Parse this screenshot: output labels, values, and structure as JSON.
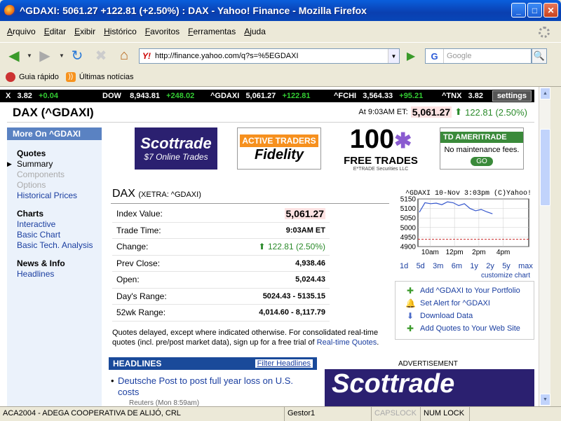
{
  "window": {
    "title": "^GDAXI: 5061.27 +122.81 (+2.50%) : DAX - Yahoo! Finance - Mozilla Firefox",
    "minimize": "_",
    "maximize": "□",
    "close": "✕"
  },
  "menu": [
    "Arquivo",
    "Editar",
    "Exibir",
    "Histórico",
    "Favoritos",
    "Ferramentas",
    "Ajuda"
  ],
  "nav": {
    "url": "http://finance.yahoo.com/q?s=%5EGDAXI",
    "url_favicon": "Y!",
    "search_engine": "G",
    "search_placeholder": "Google"
  },
  "bookmarks": [
    {
      "label": "Guia rápido",
      "icon": "bookmark-star-icon"
    },
    {
      "label": "Últimas notícias",
      "icon": "rss-icon"
    }
  ],
  "ticker": [
    {
      "sym": "X",
      "val": "3.82",
      "chg": "+0.04"
    },
    {
      "sym": "DOW",
      "val": "8,943.81",
      "chg": "+248.02"
    },
    {
      "sym": "^GDAXI",
      "val": "5,061.27",
      "chg": "+122.81"
    },
    {
      "sym": "^FCHI",
      "val": "3,564.33",
      "chg": "+95.21"
    },
    {
      "sym": "^TNX",
      "val": "3.82",
      "chg": ""
    }
  ],
  "ticker_settings": "settings",
  "quote": {
    "name": "DAX (^GDAXI)",
    "time_prefix": "At 9:03AM ET:",
    "price": "5,061.27",
    "change": "122.81 (2.50%)"
  },
  "sidebar": {
    "header": "More On ^GDAXI",
    "groups": [
      {
        "title": "Quotes",
        "items": [
          {
            "label": "Summary",
            "state": "current"
          },
          {
            "label": "Components",
            "state": "disabled"
          },
          {
            "label": "Options",
            "state": "disabled"
          },
          {
            "label": "Historical Prices",
            "state": "link"
          }
        ]
      },
      {
        "title": "Charts",
        "items": [
          {
            "label": "Interactive",
            "state": "link"
          },
          {
            "label": "Basic Chart",
            "state": "link"
          },
          {
            "label": "Basic Tech. Analysis",
            "state": "link"
          }
        ]
      },
      {
        "title": "News & Info",
        "items": [
          {
            "label": "Headlines",
            "state": "link"
          }
        ]
      }
    ]
  },
  "ads": {
    "scottrade_brand": "Scottrade",
    "scottrade_tag": "$7 Online Trades",
    "fidelity_top": "ACTIVE TRADERS",
    "fidelity_brand": "Fidelity",
    "etrade_num": "100",
    "etrade_text": "FREE TRADES",
    "etrade_small": "E*TRADE Securities LLC",
    "ameritrade_brand": "TD AMERITRADE",
    "ameritrade_msg": "No maintenance fees.",
    "ameritrade_go": "GO"
  },
  "quote_table": {
    "title": "DAX",
    "exchange": "(XETRA: ^GDAXI)",
    "rows": [
      {
        "label": "Index Value:",
        "value": "5,061.27"
      },
      {
        "label": "Trade Time:",
        "value": "9:03AM ET"
      },
      {
        "label": "Change:",
        "value": "122.81 (2.50%)"
      },
      {
        "label": "Prev Close:",
        "value": "4,938.46"
      },
      {
        "label": "Open:",
        "value": "5,024.43"
      },
      {
        "label": "Day's Range:",
        "value": "5024.43 - 5135.15"
      },
      {
        "label": "52wk Range:",
        "value": "4,014.60 - 8,117.79"
      }
    ]
  },
  "disclaimer": "Quotes delayed, except where indicated otherwise. For consolidated real-time quotes (incl. pre/post market data), sign up for a free trial of",
  "disclaimer_link": "Real-time Quotes",
  "chart_data": {
    "type": "line",
    "title": "^GDAXI 10-Nov 3:03pm (C)Yahoo!",
    "x": [
      "9:05",
      "9:30",
      "10:00",
      "10:30",
      "11:00",
      "11:30",
      "12:00",
      "12:30",
      "13:00",
      "13:30",
      "14:00",
      "14:30",
      "15:00",
      "15:03"
    ],
    "y": [
      5080,
      5130,
      5125,
      5128,
      5120,
      5135,
      5130,
      5115,
      5125,
      5100,
      5088,
      5095,
      5082,
      5072
    ],
    "prev_close": 4938.46,
    "yticks": [
      "5150",
      "5100",
      "5050",
      "5000",
      "4950",
      "4900"
    ],
    "xticks": [
      "10am",
      "12pm",
      "2pm",
      "4pm"
    ],
    "ylim": [
      4900,
      5150
    ]
  },
  "chart_periods": [
    "1d",
    "5d",
    "3m",
    "6m",
    "1y",
    "2y",
    "5y",
    "max"
  ],
  "chart_customize": "customize chart",
  "actions": [
    {
      "label": "Add ^GDAXI to Your Portfolio",
      "icon": "plus-icon"
    },
    {
      "label": "Set Alert for ^GDAXI",
      "icon": "bell-icon"
    },
    {
      "label": "Download Data",
      "icon": "download-icon"
    },
    {
      "label": "Add Quotes to Your Web Site",
      "icon": "plus-icon"
    }
  ],
  "headlines": {
    "title": "HEADLINES",
    "filter": "Filter Headlines",
    "items": [
      {
        "text": "Deutsche Post to post full year loss on U.S. costs",
        "source": "Reuters (Mon 8:59am)"
      }
    ]
  },
  "advertisement_label": "ADVERTISEMENT",
  "bottom_ad": "Scottrade",
  "status": [
    "ACA2004 - ADEGA COOPERATIVA DE ALIJÓ, CRL",
    "Gestor1",
    "CAPSLOCK",
    "NUM LOCK"
  ],
  "colors": {
    "up": "#2a8a2a",
    "link": "#1a3ea0",
    "price_bg": "#fde3e3"
  }
}
